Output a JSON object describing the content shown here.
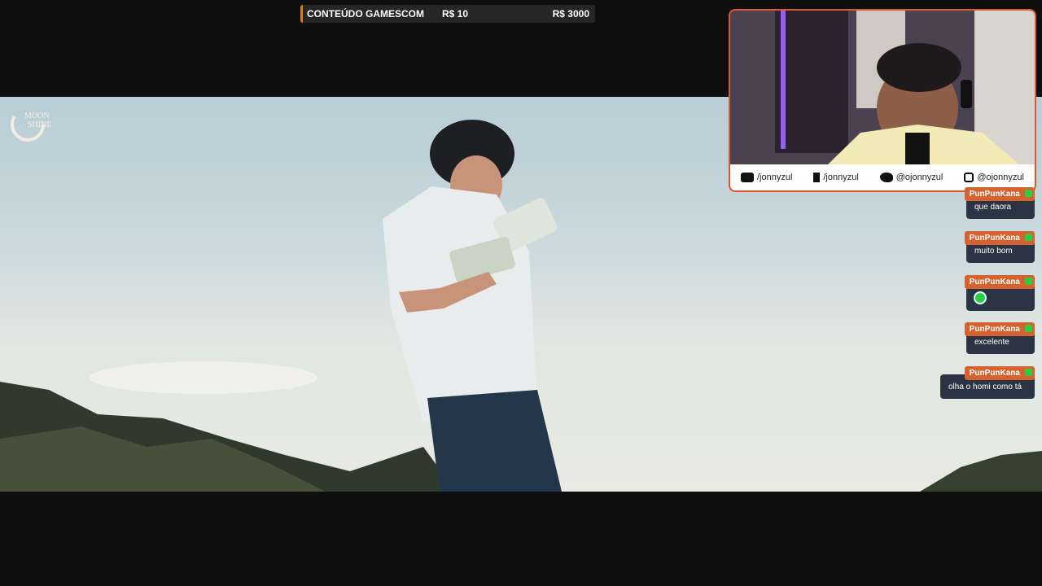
{
  "goal": {
    "title": "CONTEÚDO GAMESCOM",
    "current": "R$ 10",
    "target": "R$ 3000",
    "progress": 0.0033,
    "accent": "#e07a1f"
  },
  "video": {
    "logo_line1": "MOON",
    "logo_line2": "SHINE"
  },
  "social": {
    "youtube": "/jonnyzul",
    "facebook": "/jonnyzul",
    "twitter": "@ojonnyzul",
    "instagram": "@ojonnyzul"
  },
  "chat": [
    {
      "user": "PunPunKana",
      "text": "que daora"
    },
    {
      "user": "PunPunKana",
      "text": "muito bom"
    },
    {
      "user": "PunPunKana",
      "text": "",
      "emote": "emote"
    },
    {
      "user": "PunPunKana",
      "text": "excelente"
    },
    {
      "user": "PunPunKana",
      "text": "olha o homi como tá"
    }
  ]
}
